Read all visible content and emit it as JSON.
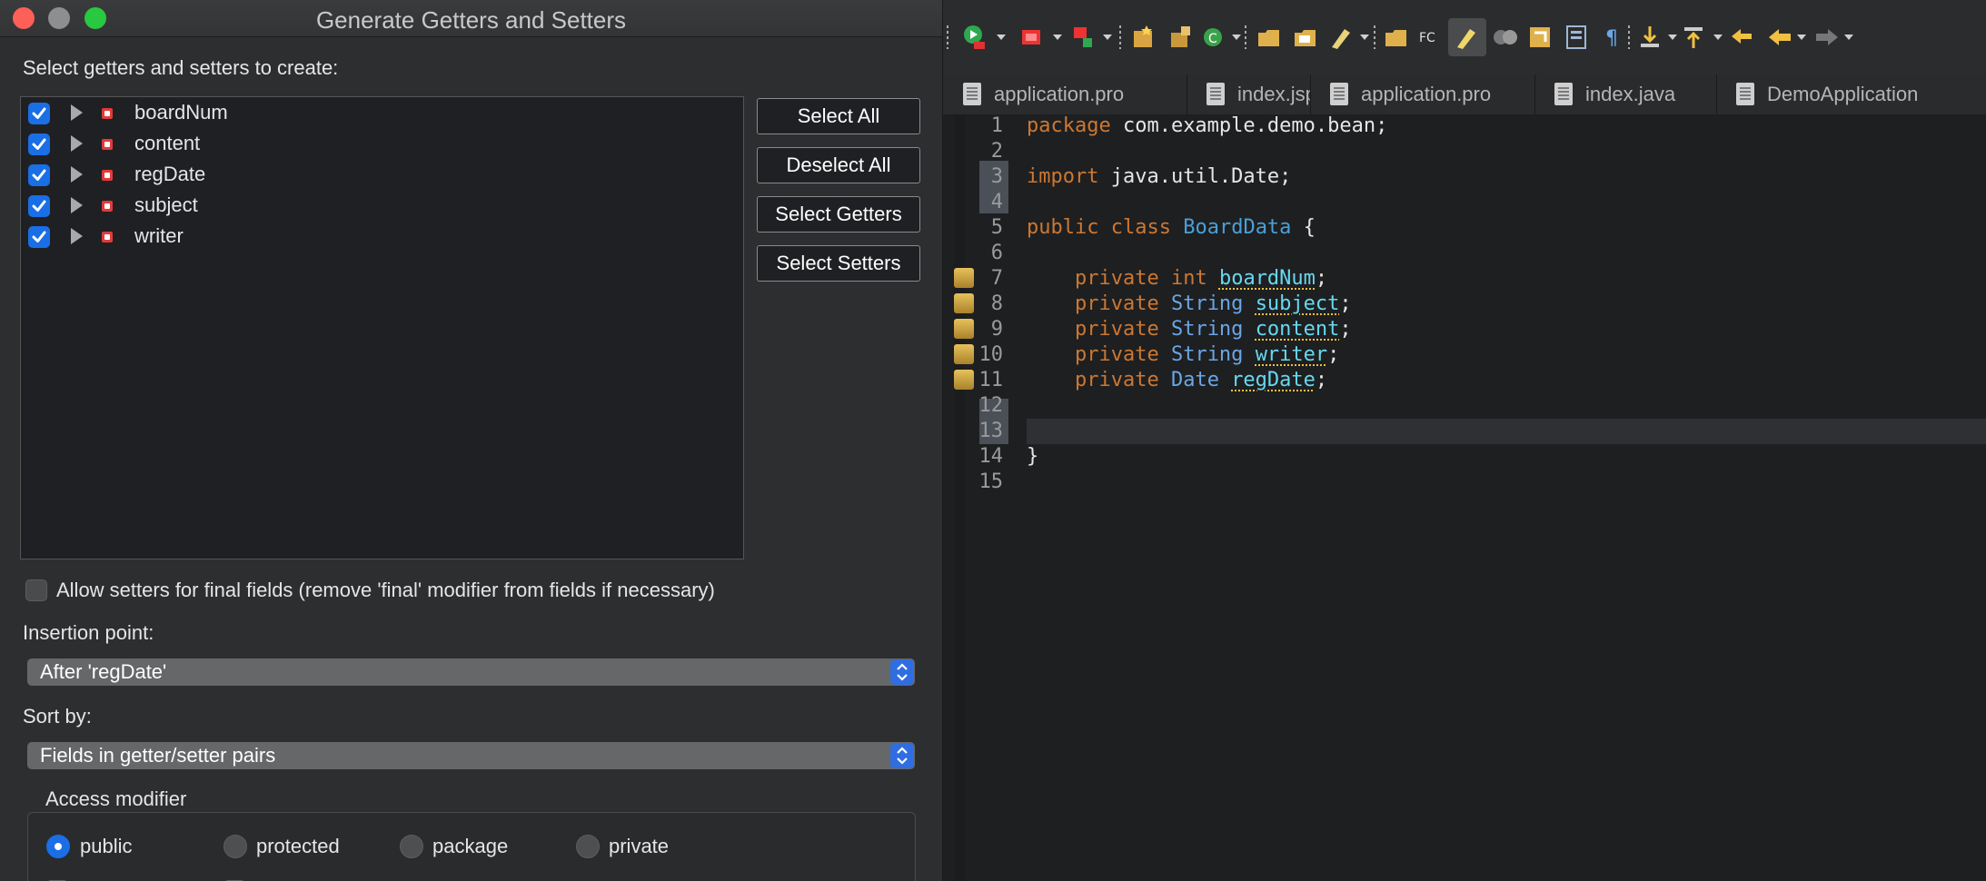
{
  "dialog": {
    "title": "Generate Getters and Setters",
    "select_label": "Select getters and setters to create:",
    "fields": [
      {
        "name": "boardNum",
        "checked": true
      },
      {
        "name": "content",
        "checked": true
      },
      {
        "name": "regDate",
        "checked": true
      },
      {
        "name": "subject",
        "checked": true
      },
      {
        "name": "writer",
        "checked": true
      }
    ],
    "buttons": {
      "select_all": "Select All",
      "deselect_all": "Deselect All",
      "select_getters": "Select Getters",
      "select_setters": "Select Setters"
    },
    "allow_final_label": "Allow setters for final fields (remove 'final' modifier from fields if necessary)",
    "insertion_point_label": "Insertion point:",
    "insertion_point_value": "After 'regDate'",
    "sort_by_label": "Sort by:",
    "sort_by_value": "Fields in getter/setter pairs",
    "access_modifier": {
      "label": "Access modifier",
      "options": [
        "public",
        "protected",
        "package",
        "private"
      ],
      "selected": "public"
    }
  },
  "ide": {
    "tabs": [
      "application.pro",
      "index.jsp",
      "application.pro",
      "index.java",
      "DemoApplication"
    ],
    "line_numbers": [
      "1",
      "2",
      "3",
      "4",
      "5",
      "6",
      "7",
      "8",
      "9",
      "10",
      "11",
      "12",
      "13",
      "14",
      "15"
    ],
    "code": {
      "package_kw": "package",
      "package_name": " com.example.demo.bean;",
      "import_kw": "import",
      "import_name": " java.util.Date;",
      "public_kw": "public",
      "class_kw": "class",
      "class_name": "BoardData",
      "open_brace": " {",
      "private_kw": "private",
      "fields": [
        {
          "type": "int",
          "name": "boardNum"
        },
        {
          "type": "String",
          "name": "subject"
        },
        {
          "type": "String",
          "name": "content"
        },
        {
          "type": "String",
          "name": "writer"
        },
        {
          "type": "Date",
          "name": "regDate"
        }
      ],
      "semicolon": ";",
      "close_brace": "}"
    }
  },
  "colors": {
    "keyword": "#cc7832",
    "type": "#6aa6e6",
    "field": "#66d9ef",
    "accent": "#1a6ee6",
    "close": "#fe5f57",
    "maximize": "#28c840"
  }
}
